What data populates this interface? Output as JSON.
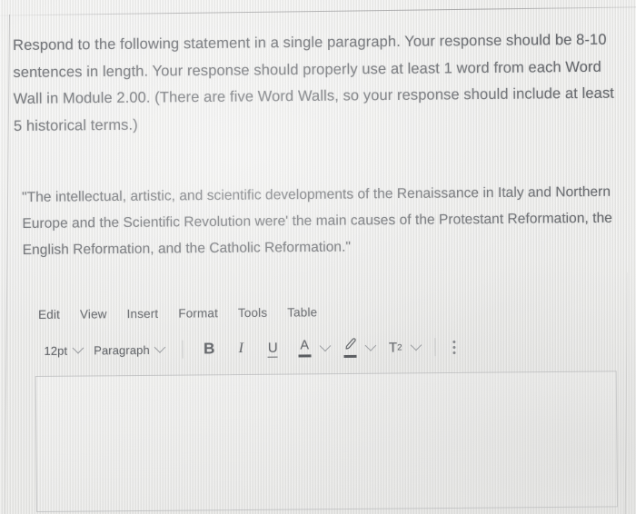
{
  "prompt": {
    "text": "Respond to the following statement in a single paragraph.  Your response should be 8-10 sentences in length.  Your response should properly use at least 1 word from each Word Wall in Module 2.00.  (There are five Word Walls, so your response should include at least 5 historical terms.)"
  },
  "statement": {
    "text": "\"The intellectual, artistic, and scientific developments of the Renaissance in Italy and Northern Europe and the Scientific Revolution were' the main causes of the Protestant Reformation, the English Reformation, and the Catholic Reformation.\""
  },
  "editor": {
    "menu": [
      {
        "label": "Edit"
      },
      {
        "label": "View"
      },
      {
        "label": "Insert"
      },
      {
        "label": "Format"
      },
      {
        "label": "Tools"
      },
      {
        "label": "Table"
      }
    ],
    "toolbar": {
      "font_size": "12pt",
      "block_format": "Paragraph",
      "bold": "B",
      "italic": "I",
      "underline": "U",
      "text_color_glyph": "A",
      "superscript_glyph": "T",
      "superscript_exponent": "2",
      "more_options": "⋮"
    },
    "content": ""
  },
  "colors": {
    "page_background": "#e9e9e7",
    "body_text": "#53565b",
    "toolbar_text": "#4f5257",
    "icon": "#4b4e53",
    "rule": "#9a9c9f"
  }
}
